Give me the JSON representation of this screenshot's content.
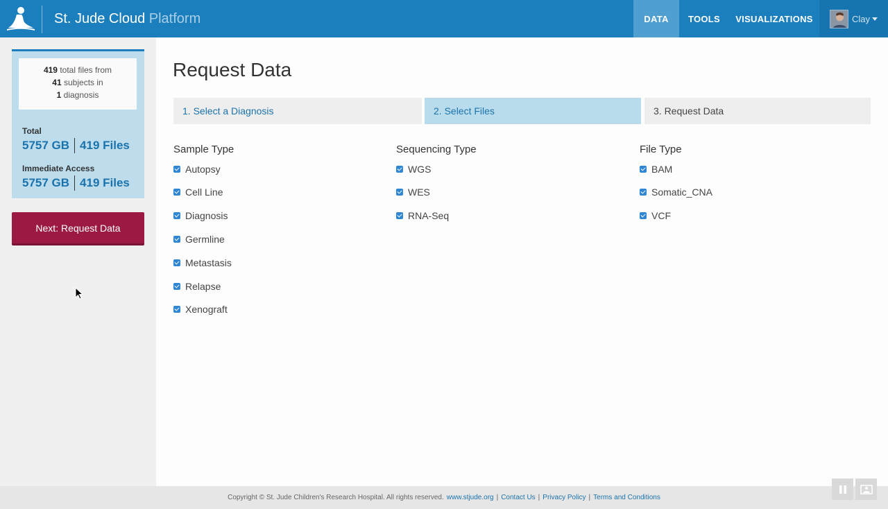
{
  "header": {
    "brand_main": "St. Jude Cloud",
    "brand_sub": "Platform",
    "nav": [
      {
        "label": "DATA",
        "active": true
      },
      {
        "label": "TOOLS",
        "active": false
      },
      {
        "label": "VISUALIZATIONS",
        "active": false
      }
    ],
    "user": {
      "name": "Clay"
    },
    "colors": {
      "header_bg": "#1b7fbd",
      "active_nav": "#4f9fd0"
    }
  },
  "sidebar": {
    "summary": {
      "files_count": "419",
      "files_text": "total files from",
      "subjects_count": "41",
      "subjects_text": "subjects in",
      "diagnosis_count": "1",
      "diagnosis_text": "diagnosis"
    },
    "total": {
      "label": "Total",
      "size": "5757 GB",
      "files": "419 Files"
    },
    "immediate": {
      "label": "Immediate Access",
      "size": "5757 GB",
      "files": "419 Files"
    },
    "next_button": "Next: Request Data"
  },
  "main": {
    "title": "Request Data",
    "steps": [
      {
        "label": "1. Select a Diagnosis",
        "state": "link"
      },
      {
        "label": "2. Select Files",
        "state": "active"
      },
      {
        "label": "3. Request Data",
        "state": "inactive"
      }
    ],
    "columns": [
      {
        "title": "Sample Type",
        "items": [
          "Autopsy",
          "Cell Line",
          "Diagnosis",
          "Germline",
          "Metastasis",
          "Relapse",
          "Xenograft"
        ]
      },
      {
        "title": "Sequencing Type",
        "items": [
          "WGS",
          "WES",
          "RNA-Seq"
        ]
      },
      {
        "title": "File Type",
        "items": [
          "BAM",
          "Somatic_CNA",
          "VCF"
        ]
      }
    ]
  },
  "footer": {
    "copyright": "Copyright © St. Jude Children's Research Hospital. All rights reserved.",
    "links": [
      "www.stjude.org",
      "Contact Us",
      "Privacy Policy",
      "Terms and Conditions"
    ]
  },
  "icons": [
    "st-jude-logo-icon",
    "chevron-down-icon",
    "checkbox-checked-icon",
    "pause-icon",
    "image-icon",
    "mouse-cursor-icon"
  ]
}
